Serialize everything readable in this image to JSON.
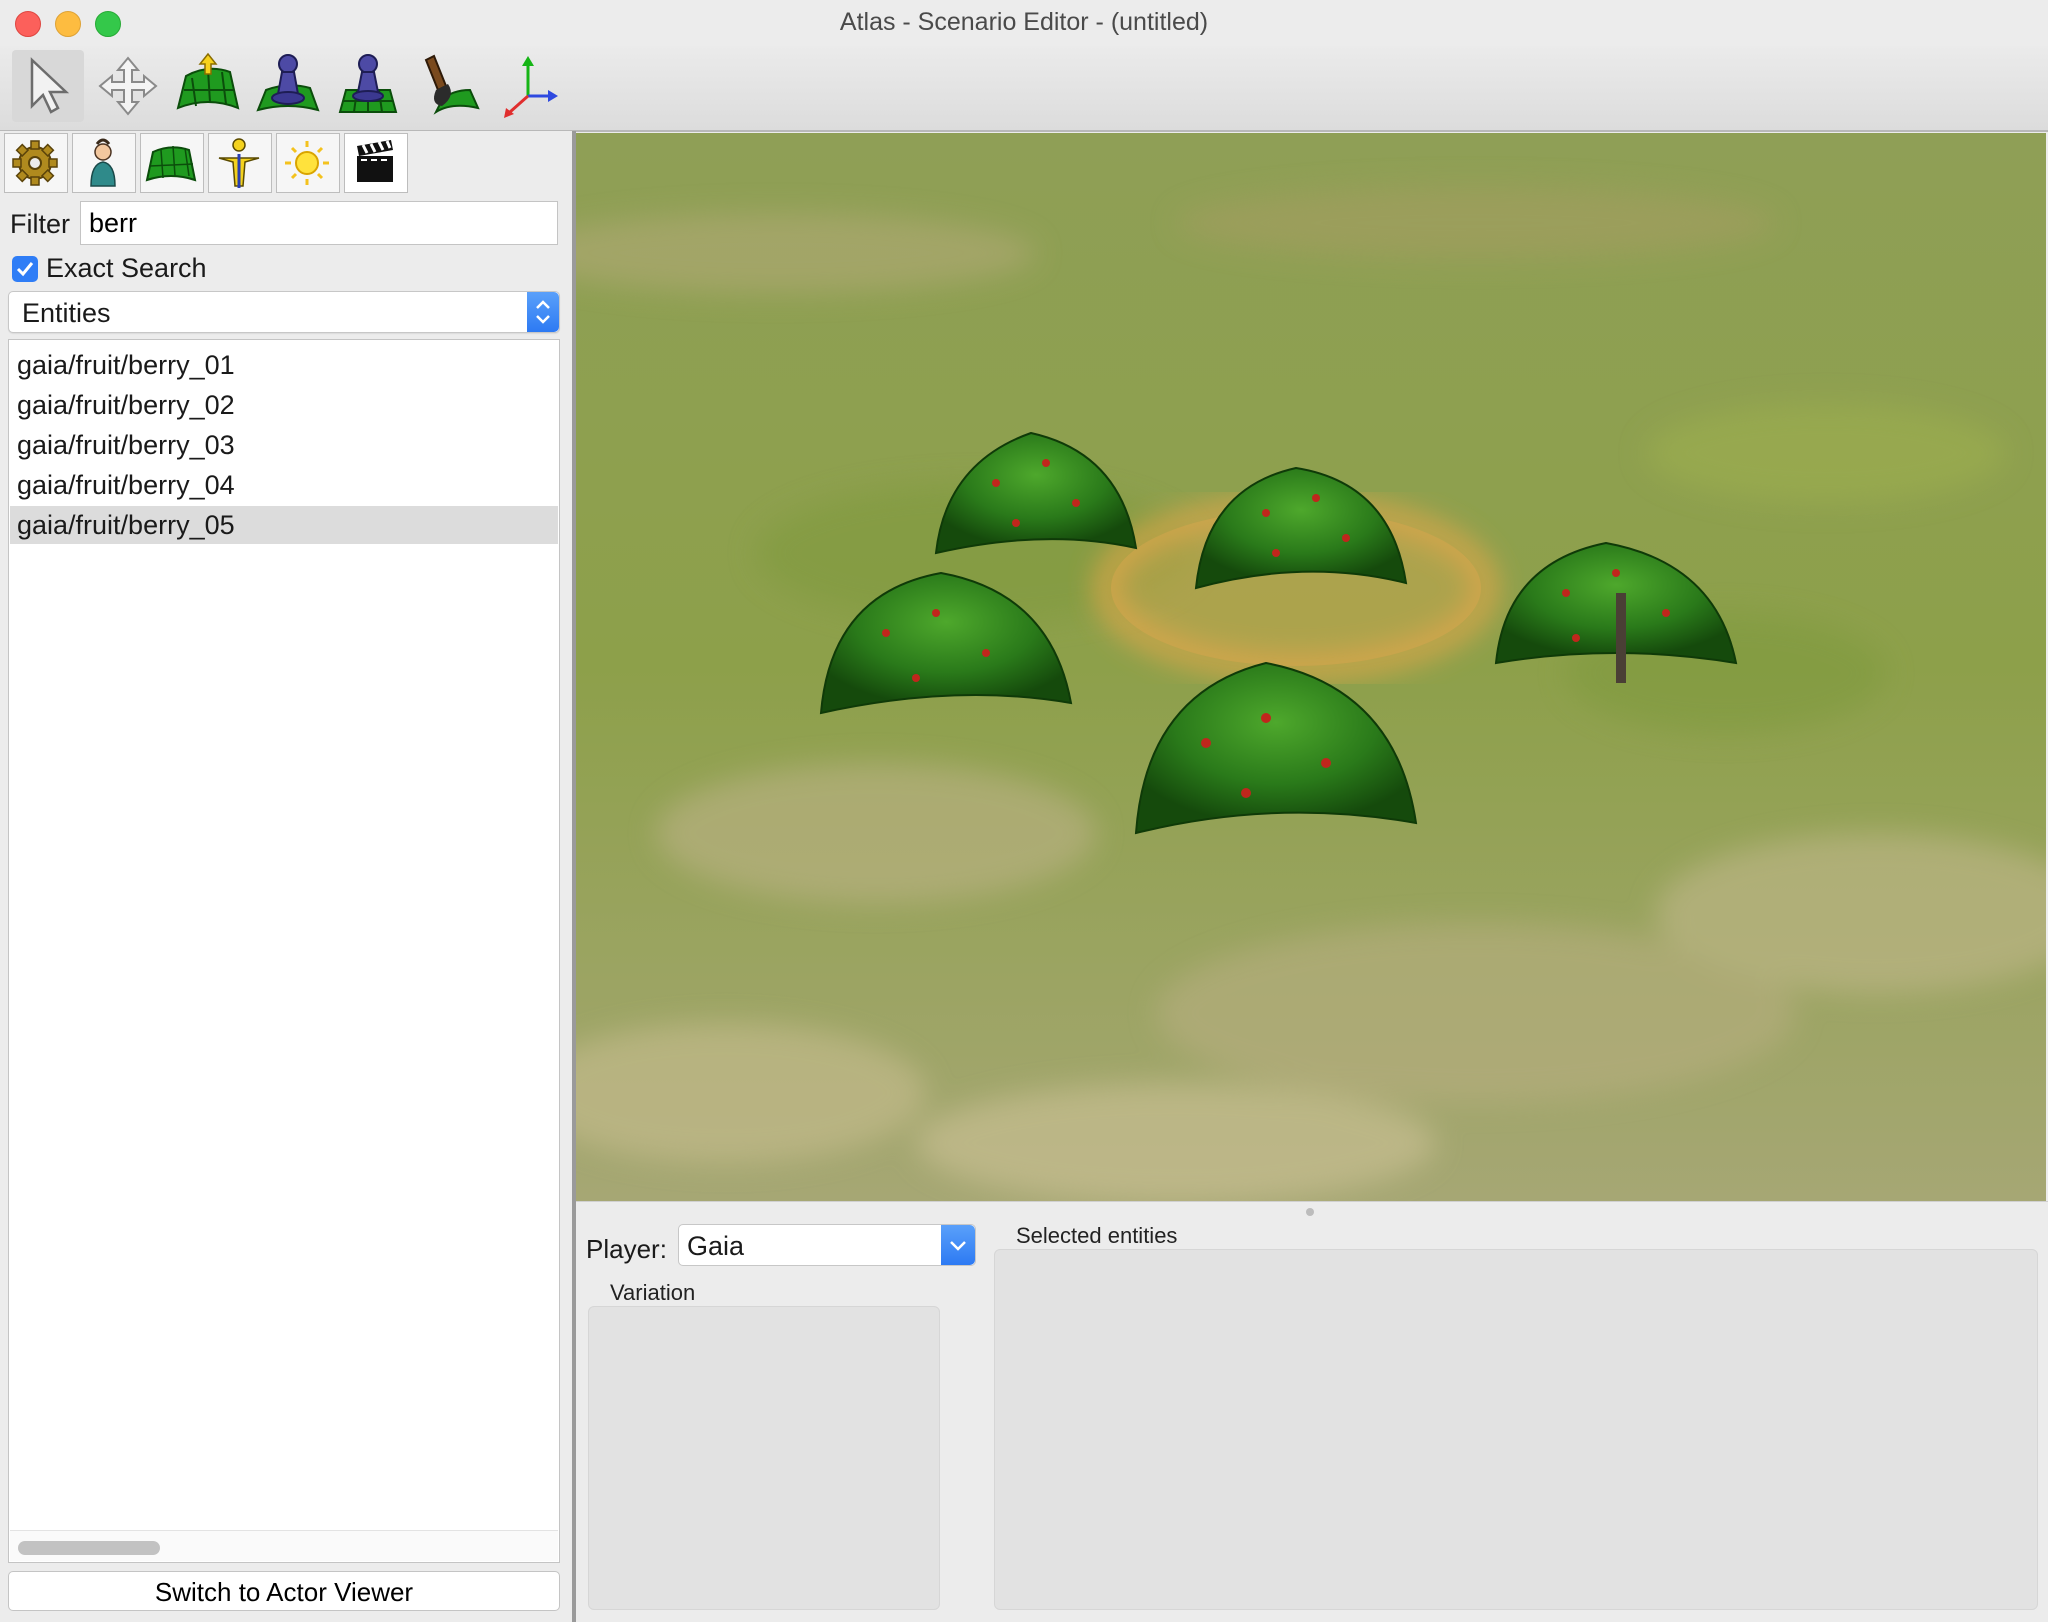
{
  "window": {
    "title": "Atlas - Scenario Editor - (untitled)"
  },
  "toolbar": {
    "tools": [
      {
        "name": "select-tool",
        "icon": "pointer-arrow-icon"
      },
      {
        "name": "transform-tool",
        "icon": "move-cross-icon"
      },
      {
        "name": "alter-elevation-tool",
        "icon": "terrain-raise-icon"
      },
      {
        "name": "place-object-tool",
        "icon": "pawn-icon"
      },
      {
        "name": "paint-territory-tool",
        "icon": "pawn-grid-icon"
      },
      {
        "name": "paint-terrain-tool",
        "icon": "paint-brush-icon"
      },
      {
        "name": "axes-tool",
        "icon": "xyz-axes-icon"
      }
    ]
  },
  "sidebar": {
    "section_tabs": [
      {
        "name": "map-settings",
        "icon": "gear-icon"
      },
      {
        "name": "players",
        "icon": "player-icon"
      },
      {
        "name": "terrain",
        "icon": "terrain-icon"
      },
      {
        "name": "object",
        "icon": "unit-icon"
      },
      {
        "name": "environment",
        "icon": "sun-icon"
      },
      {
        "name": "cinematic",
        "icon": "clapperboard-icon"
      }
    ],
    "filter_label": "Filter",
    "filter_value": "berr",
    "exact_search_label": "Exact Search",
    "exact_search_checked": true,
    "type_select": "Entities",
    "entities": [
      "gaia/fruit/berry_01",
      "gaia/fruit/berry_02",
      "gaia/fruit/berry_03",
      "gaia/fruit/berry_04",
      "gaia/fruit/berry_05"
    ],
    "selected_entity_index": 4,
    "switch_button": "Switch to Actor Viewer"
  },
  "bottom_panel": {
    "player_label": "Player:",
    "player_value": "Gaia",
    "variation_label": "Variation",
    "selected_entities_label": "Selected entities"
  },
  "colors": {
    "accent": "#2f7df6",
    "grass": "#8a9e4a",
    "bush": "#2e7a1e",
    "berries": "#c0261c",
    "selection_ring": "#f0a84a"
  }
}
